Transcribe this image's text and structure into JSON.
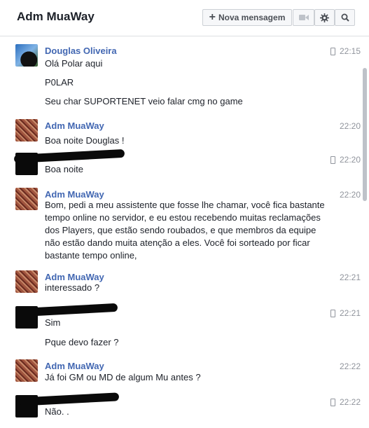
{
  "header": {
    "title": "Adm MuaWay",
    "new_message_label": "Nova mensagem",
    "icons": [
      "video-icon",
      "gear-icon",
      "search-icon"
    ]
  },
  "messages": [
    {
      "sender": "Douglas Oliveira",
      "time": "22:15",
      "mobile": true,
      "lines": [
        "Olá Polar aqui",
        "P0LAR",
        "Seu char SUPORTENET veio falar cmg no game"
      ]
    },
    {
      "sender": "Adm MuaWay",
      "time": "22:20",
      "mobile": false,
      "lines": [
        "Boa noite Douglas !"
      ]
    },
    {
      "sender": "",
      "time": "22:20",
      "mobile": true,
      "lines": [
        "Boa noite"
      ]
    },
    {
      "sender": "Adm MuaWay",
      "time": "22:20",
      "mobile": false,
      "lines": [
        "Bom, pedi a meu assistente que fosse lhe chamar, você fica bastante tempo online no servidor, e eu estou recebendo muitas reclamações dos Players, que estão sendo roubados, e que membros da equipe não estão dando muita atenção a eles. Você foi sorteado por ficar bastante tempo online,"
      ]
    },
    {
      "sender": "Adm MuaWay",
      "time": "22:21",
      "mobile": false,
      "lines": [
        "interessado ?"
      ]
    },
    {
      "sender": "",
      "time": "22:21",
      "mobile": true,
      "lines": [
        "Sim",
        "Pque devo fazer ?"
      ]
    },
    {
      "sender": "Adm MuaWay",
      "time": "22:22",
      "mobile": false,
      "lines": [
        "Já foi GM ou MD de algum Mu antes ?"
      ]
    },
    {
      "sender": "",
      "time": "22:22",
      "mobile": true,
      "lines": [
        "Não. ."
      ]
    }
  ],
  "colors": {
    "accent": "#4267b2",
    "muted": "#90949c",
    "text": "#1d2129"
  }
}
